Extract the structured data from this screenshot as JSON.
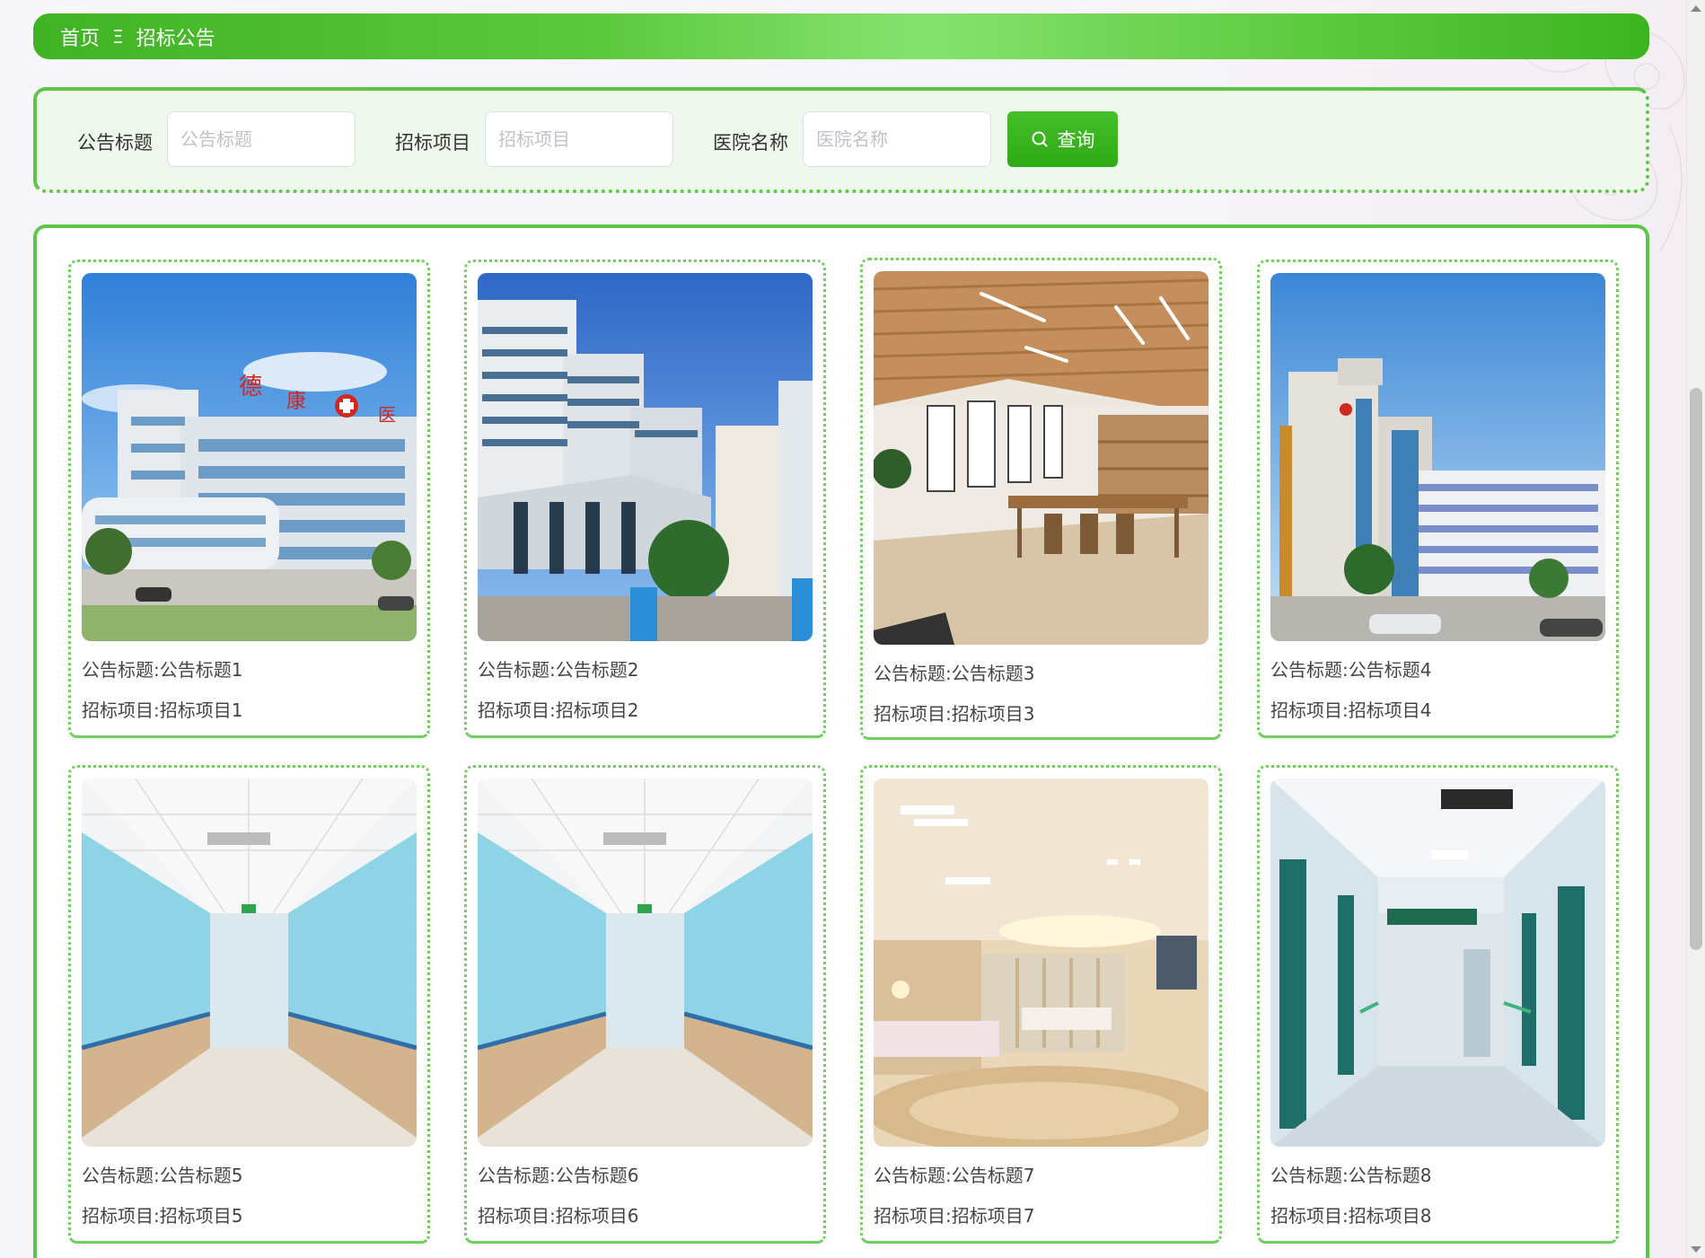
{
  "colors": {
    "accent": "#4cbf31",
    "panel_bg": "#eff8ec",
    "border": "#5fc44a",
    "text": "#333333",
    "placeholder": "#bfc2c8"
  },
  "breadcrumb": {
    "home": "首页",
    "separator": "Ξ",
    "current": "招标公告"
  },
  "search": {
    "fields": [
      {
        "label": "公告标题",
        "placeholder": "公告标题",
        "value": ""
      },
      {
        "label": "招标项目",
        "placeholder": "招标项目",
        "value": ""
      },
      {
        "label": "医院名称",
        "placeholder": "医院名称",
        "value": ""
      }
    ],
    "button_label": "查询",
    "button_icon": "search-icon"
  },
  "cards": [
    {
      "title": "公告标题:公告标题1",
      "project": "招标项目:招标项目1",
      "image": "hospital-building-exterior-image"
    },
    {
      "title": "公告标题:公告标题2",
      "project": "招标项目:招标项目2",
      "image": "hospital-towers-exterior-image"
    },
    {
      "title": "公告标题:公告标题3",
      "project": "招标项目:招标项目3",
      "image": "wooden-interior-room-image"
    },
    {
      "title": "公告标题:公告标题4",
      "project": "招标项目:招标项目4",
      "image": "hospital-building-exterior-image"
    },
    {
      "title": "公告标题:公告标题5",
      "project": "招标项目:招标项目5",
      "image": "hospital-corridor-image"
    },
    {
      "title": "公告标题:公告标题6",
      "project": "招标项目:招标项目6",
      "image": "hospital-corridor-image"
    },
    {
      "title": "公告标题:公告标题7",
      "project": "招标项目:招标项目7",
      "image": "hospital-ward-interior-image"
    },
    {
      "title": "公告标题:公告标题8",
      "project": "招标项目:招标项目8",
      "image": "hospital-hallway-image"
    }
  ]
}
